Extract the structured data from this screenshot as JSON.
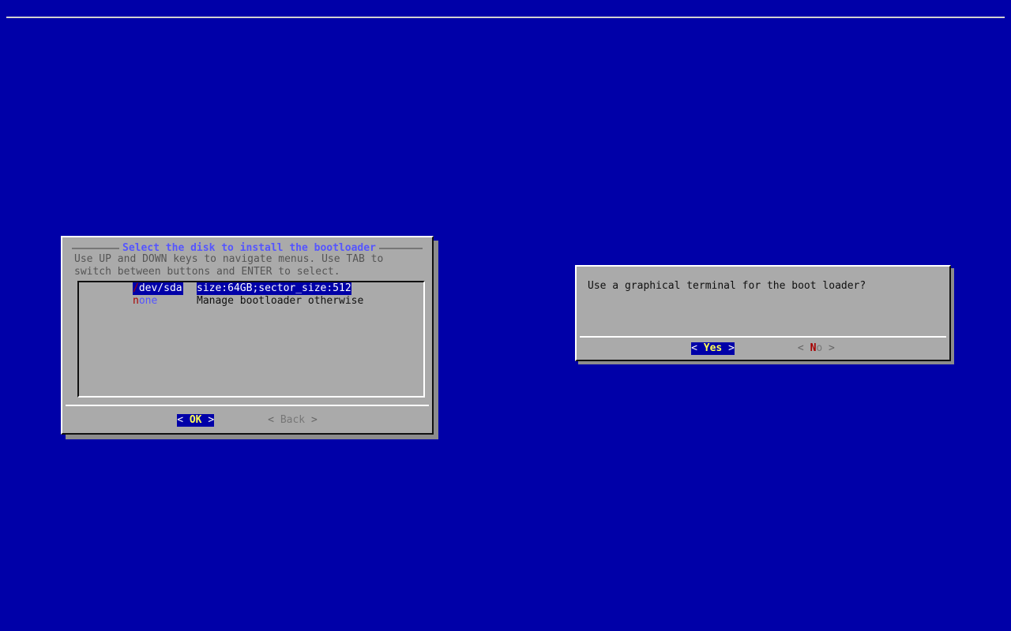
{
  "screen": {
    "background_color": "#0000a8",
    "top_rule_color": "#d0d0d0"
  },
  "dialogs": [
    {
      "id": "disk-select",
      "title": "Select the disk to install the bootloader",
      "title_color": "#5555ff",
      "body": "Use UP and DOWN keys to navigate menus. Use TAB to\nswitch between buttons and ENTER to select.",
      "list": {
        "items": [
          {
            "hotkey": "/",
            "tag_rest": "dev/sda",
            "description": "size:64GB;sector_size:512",
            "selected": true
          },
          {
            "hotkey": "n",
            "tag_rest": "one",
            "description": "Manage bootloader otherwise",
            "selected": false
          }
        ]
      },
      "buttons": [
        {
          "label": "OK",
          "left_bracket": "<",
          "right_bracket": ">",
          "active": true
        },
        {
          "label": "Back",
          "left_bracket": "<",
          "right_bracket": ">",
          "active": false
        }
      ]
    },
    {
      "id": "graphical-terminal-prompt",
      "message": "Use a graphical terminal for the boot loader?",
      "buttons": [
        {
          "label": "Yes",
          "hotkey": "",
          "label_rest": "Yes",
          "left_bracket": "<",
          "right_bracket": ">",
          "active": true
        },
        {
          "label": "No",
          "hotkey": "N",
          "label_rest": "o",
          "left_bracket": "<",
          "right_bracket": ">",
          "active": false
        }
      ]
    }
  ],
  "colors": {
    "desktop_blue": "#0000a8",
    "dialog_gray": "#aaaaaa",
    "highlight_blue": "#0000a8",
    "hotkey_red": "#a80000",
    "active_label_yellow": "#ffff55",
    "inactive_text_gray": "#666666",
    "title_blue": "#5555ff",
    "shadow_gray": "#8c8c8c"
  }
}
